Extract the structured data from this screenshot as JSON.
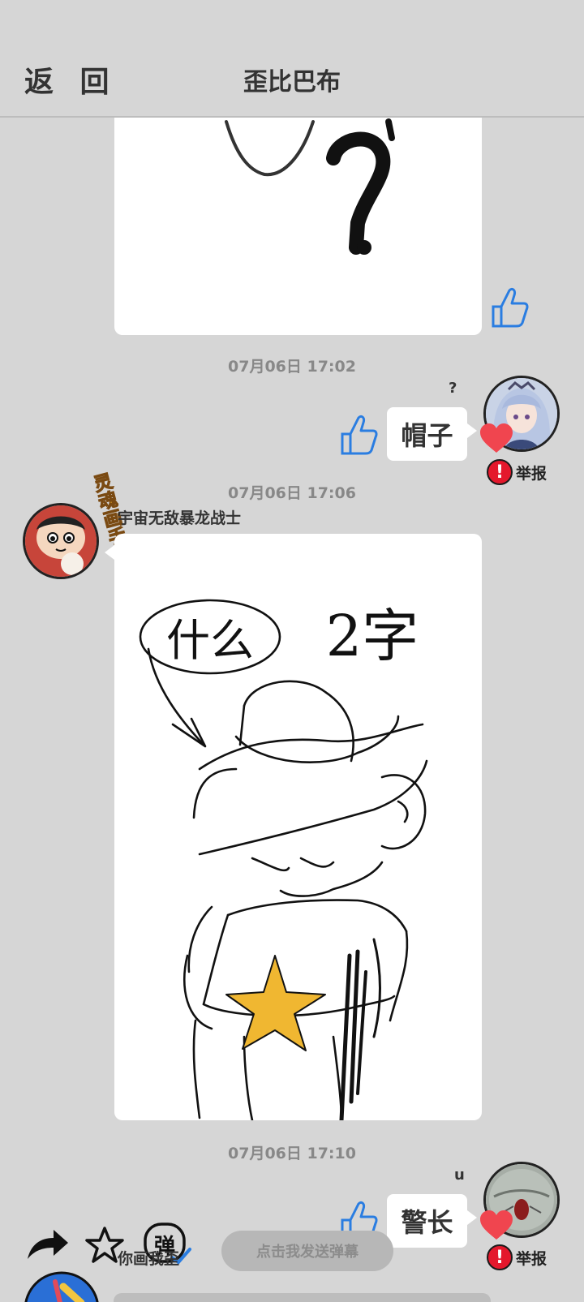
{
  "header": {
    "back_label": "返 回",
    "title": "歪比巴布"
  },
  "messages": [
    {
      "type": "drawing",
      "drawing_text": "?"
    },
    {
      "timestamp": "07月06日  17:02"
    },
    {
      "type": "guess",
      "user_tag": "?",
      "text": "帽子",
      "report_label": "举报"
    },
    {
      "timestamp": "07月06日  17:06"
    },
    {
      "type": "drawing",
      "sender": "宇宙无敌暴龙战士",
      "avatar_badge": "灵魂画手",
      "drawing_bubble_text": "什么",
      "drawing_text": "2字"
    },
    {
      "timestamp": "07月06日  17:10"
    },
    {
      "type": "guess",
      "user_tag": "u",
      "text": "警长",
      "report_label": "举报"
    }
  ],
  "bottom": {
    "danmu_icon_label": "弹",
    "danmu_button": "点击我发送弹幕",
    "game_label": "你画我歪"
  },
  "colors": {
    "background": "#d6d6d6",
    "like_blue": "#2a7de1",
    "heart_red": "#f0454f",
    "report_red": "#e4182c",
    "star_yellow": "#f0b731"
  }
}
